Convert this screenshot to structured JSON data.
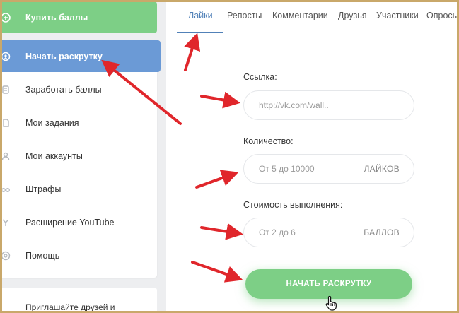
{
  "sidebar": {
    "items": [
      {
        "label": "Купить баллы",
        "icon": "plus-circle-icon"
      },
      {
        "label": "Начать раскрутку",
        "icon": "rocket-icon"
      },
      {
        "label": "Заработать баллы",
        "icon": "coins-icon"
      },
      {
        "label": "Мои задания",
        "icon": "document-icon"
      },
      {
        "label": "Мои аккаунты",
        "icon": "user-icon"
      },
      {
        "label": "Штрафы",
        "icon": "glasses-icon"
      },
      {
        "label": "Расширение YouTube",
        "icon": "extension-icon"
      },
      {
        "label": "Помощь",
        "icon": "help-icon"
      }
    ],
    "invite_text": "Приглашайте друзей и"
  },
  "tabs": [
    "Лайки",
    "Репосты",
    "Комментарии",
    "Друзья",
    "Участники",
    "Опросы"
  ],
  "active_tab": "Лайки",
  "form": {
    "link_label": "Ссылка:",
    "link_placeholder": "http://vk.com/wall..",
    "qty_label": "Количество:",
    "qty_placeholder": "От 5 до 10000",
    "qty_suffix": "ЛАЙКОВ",
    "cost_label": "Стоимость выполнения:",
    "cost_placeholder": "От 2 до 6",
    "cost_suffix": "БАЛЛОВ",
    "submit_label": "НАЧАТЬ РАСКРУТКУ"
  },
  "colors": {
    "green": "#7dcf86",
    "blue": "#6b9ad6",
    "tab_active": "#5181b8",
    "annotation_arrow": "#e0262b"
  }
}
